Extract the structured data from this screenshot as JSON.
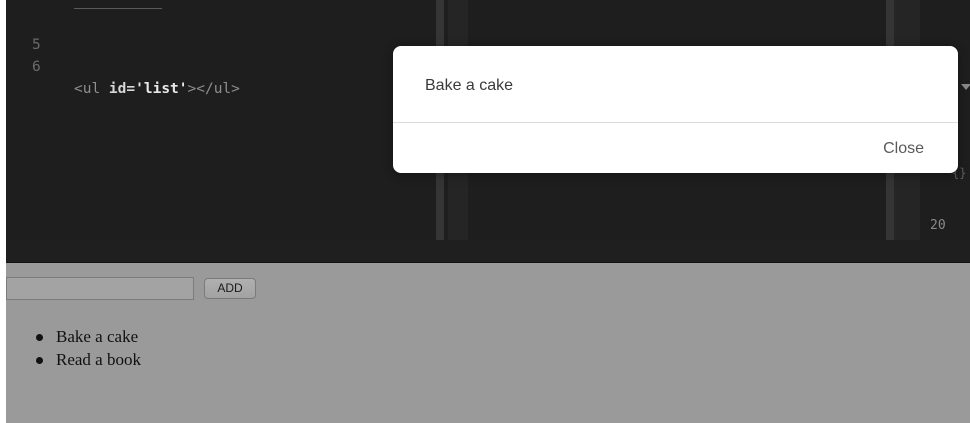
{
  "editor": {
    "lines": [
      {
        "number": "5",
        "parts": []
      },
      {
        "number": "6",
        "parts": [
          {
            "text": "<ul ",
            "kind": "tag"
          },
          {
            "text": "id=",
            "kind": "attr"
          },
          {
            "text": "'list'",
            "kind": "val"
          },
          {
            "text": "></ul>",
            "kind": "tag"
          }
        ]
      }
    ],
    "right_line_number": "20"
  },
  "output": {
    "input_value": "",
    "add_label": "ADD",
    "items": [
      "Bake a cake",
      "Read a book"
    ]
  },
  "modal": {
    "message": "Bake a cake",
    "close_label": "Close"
  }
}
